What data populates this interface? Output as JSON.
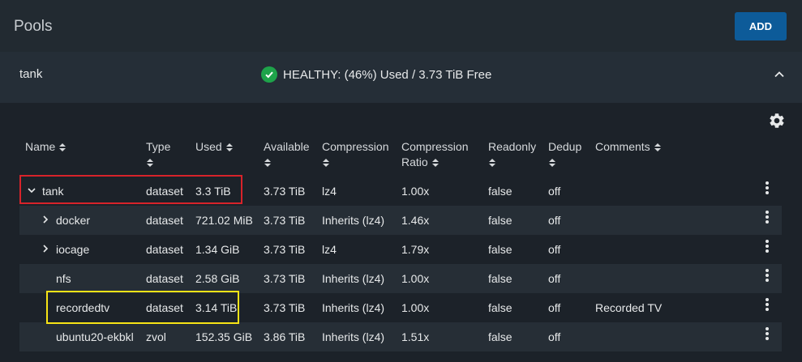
{
  "header": {
    "title": "Pools",
    "add_label": "ADD"
  },
  "pool": {
    "name": "tank",
    "status": "HEALTHY: (46%) Used / 3.73 TiB Free",
    "status_color": "#1ea34a"
  },
  "icons": {
    "status": "check-circle-icon",
    "collapse": "chevron-up-icon",
    "settings": "gear-icon",
    "row_menu": "more-vert-icon",
    "expand": "chevron-right-icon",
    "expanded": "chevron-down-icon"
  },
  "table": {
    "columns": {
      "name": "Name",
      "type": "Type",
      "used": "Used",
      "available": "Available",
      "compression": "Compression",
      "ratio_line1": "Compression",
      "ratio_line2": "Ratio",
      "readonly": "Readonly",
      "dedup": "Dedup",
      "comments": "Comments"
    },
    "rows": [
      {
        "name": "tank",
        "type": "dataset",
        "used": "3.3 TiB",
        "available": "3.73 TiB",
        "compression": "lz4",
        "ratio": "1.00x",
        "readonly": "false",
        "dedup": "off",
        "comments": ""
      },
      {
        "name": "docker",
        "type": "dataset",
        "used": "721.02 MiB",
        "available": "3.73 TiB",
        "compression": "Inherits (lz4)",
        "ratio": "1.46x",
        "readonly": "false",
        "dedup": "off",
        "comments": ""
      },
      {
        "name": "iocage",
        "type": "dataset",
        "used": "1.34 GiB",
        "available": "3.73 TiB",
        "compression": "lz4",
        "ratio": "1.79x",
        "readonly": "false",
        "dedup": "off",
        "comments": ""
      },
      {
        "name": "nfs",
        "type": "dataset",
        "used": "2.58 GiB",
        "available": "3.73 TiB",
        "compression": "Inherits (lz4)",
        "ratio": "1.00x",
        "readonly": "false",
        "dedup": "off",
        "comments": ""
      },
      {
        "name": "recordedtv",
        "type": "dataset",
        "used": "3.14 TiB",
        "available": "3.73 TiB",
        "compression": "Inherits (lz4)",
        "ratio": "1.00x",
        "readonly": "false",
        "dedup": "off",
        "comments": "Recorded TV"
      },
      {
        "name": "ubuntu20-ekbkl",
        "type": "zvol",
        "used": "152.35 GiB",
        "available": "3.86 TiB",
        "compression": "Inherits (lz4)",
        "ratio": "1.51x",
        "readonly": "false",
        "dedup": "off",
        "comments": ""
      }
    ]
  }
}
